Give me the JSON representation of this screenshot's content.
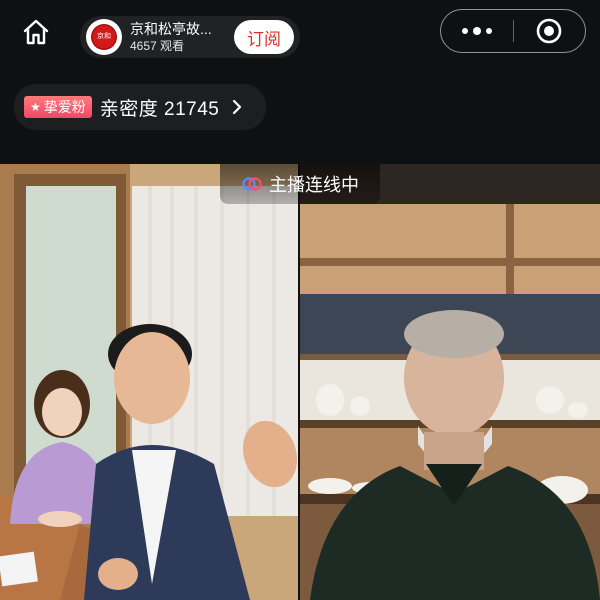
{
  "header": {
    "host_name": "京和松亭故...",
    "view_count": "4657 观看",
    "subscribe_label": "订阅",
    "avatar_text": "京和"
  },
  "affinity": {
    "badge_label": "挚爱粉",
    "text": "亲密度 21745"
  },
  "live": {
    "connect_label": "主播连线中"
  },
  "colors": {
    "accent_red": "#d3342b",
    "badge_pink": "#f2476a",
    "background": "#0f1012"
  }
}
